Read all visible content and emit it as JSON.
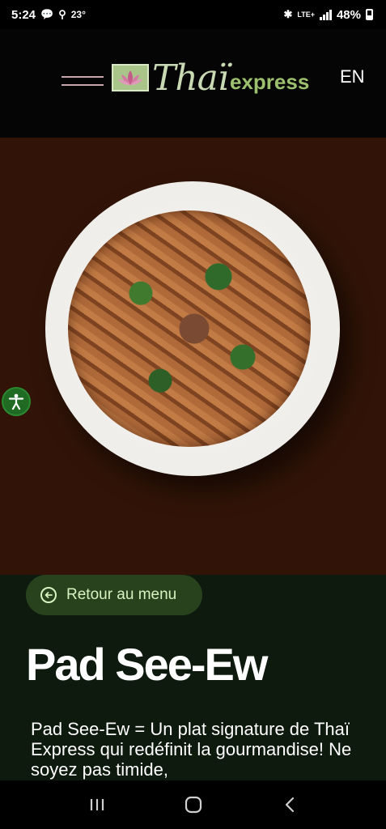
{
  "status_bar": {
    "time": "5:24",
    "temperature": "23°",
    "network": "LTE+",
    "battery": "48%"
  },
  "header": {
    "logo_thai": "Thaï",
    "logo_express": "express",
    "language": "EN"
  },
  "hero": {
    "image_alt": "Pad See-Ew dish"
  },
  "content": {
    "back_label": "Retour au menu",
    "title": "Pad See-Ew",
    "description": "Pad See-Ew = Un plat signature de Thaï Express qui redéfinit la gourmandise! Ne soyez pas timide,"
  },
  "colors": {
    "hero_bg": "#311407",
    "content_bg": "#0f1a0e",
    "back_button_bg": "#28421e",
    "back_button_text": "#d9f0bf",
    "accessibility_green": "#1f6b23",
    "logo_green": "#9cc06d"
  },
  "icons": {
    "menu": "hamburger-icon",
    "back": "arrow-left-circle-icon",
    "accessibility": "accessibility-icon",
    "nav_recent": "recent-apps-icon",
    "nav_home": "home-icon",
    "nav_back": "back-icon"
  }
}
